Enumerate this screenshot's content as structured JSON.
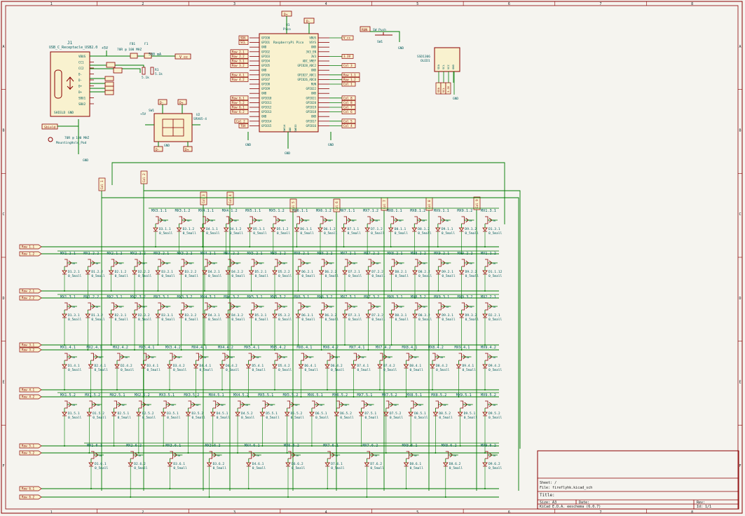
{
  "border": {
    "columns": [
      "1",
      "2",
      "3",
      "4",
      "5",
      "6",
      "7",
      "8"
    ],
    "rows": [
      "A",
      "B",
      "C",
      "D",
      "E",
      "F"
    ]
  },
  "title_block": {
    "sheet": "Sheet: /",
    "file": "File: fireflyhk.kicad_sch",
    "title": "Title:",
    "size": "Size: A3",
    "date": "Date:",
    "rev": "Rev:",
    "tool": "KiCad E.D.A.  eeschema (6.0.7)",
    "id": "Id: 1/1"
  },
  "usb": {
    "ref": "J1",
    "value": "USB_C_Receptacle_USB2.0",
    "fuse_ref": "F1",
    "fuse_value": "500 mA",
    "fb": "FB1",
    "fb_value": "70R @ 100 MHZ",
    "r1": "R1",
    "r2": "R2",
    "r_val": "5.1k",
    "net_vbus": "+5V",
    "net_vcc": "V_cc",
    "shield": "SHIELD",
    "gnd": "GND",
    "pins": [
      "VBUS",
      "CC1",
      "CC2",
      "D-",
      "D-",
      "D+",
      "D+",
      "SBU1",
      "SBU2"
    ],
    "mount_hole": "MountingHole_Pad",
    "fb2": "70R @ 100 MHZ",
    "shield_net": "Shield"
  },
  "esd": {
    "ref": "SW1",
    "chip": "U2",
    "chip_val": "SRV05-4",
    "labels": [
      "D-",
      "D+",
      "D-",
      "D+",
      "+5V"
    ],
    "gnd": "GND"
  },
  "mcu": {
    "ref": "U1",
    "value": "Pico",
    "name": "RaspberryPi Pico",
    "left_pins": [
      "GPIO0",
      "GPIO1",
      "GND",
      "GPIO2",
      "GPIO3",
      "GPIO4",
      "GPIO5",
      "GND",
      "GPIO6",
      "GPIO7",
      "GPIO8",
      "GPIO9",
      "GND",
      "GPIO10",
      "GPIO11",
      "GPIO12",
      "GPIO13",
      "GND",
      "GPIO14",
      "GPIO15"
    ],
    "right_pins": [
      "VBUS",
      "VSYS",
      "GND",
      "3V3_EN",
      "3V3",
      "ADC_VREF",
      "GPIO28_ADC2",
      "GND",
      "GPIO27_ADC1",
      "GPIO26_ADC0",
      "RUN",
      "GPIO22",
      "GND",
      "GPIO21",
      "GPIO20",
      "GPIO19",
      "GPIO18",
      "GND",
      "GPIO17",
      "GPIO16"
    ],
    "left_nets": [
      "SDA",
      "SCL",
      "",
      "Row 2.1",
      "Row 2.2",
      "Row 3.1",
      "Row 3.2",
      "",
      "Row 4.1",
      "Row 4.2",
      "",
      "",
      "",
      "Row 6.1",
      "Row 5.2",
      "Row 6.1",
      "Row 6.2",
      "",
      "Col 2",
      "TOX"
    ],
    "right_nets": [
      "V_cc",
      "",
      "",
      "",
      "3.3V",
      "",
      "Col 3",
      "",
      "Row 1.1",
      "Row 1.2",
      "Col 1",
      "",
      "",
      "Col 8",
      "Col 8",
      "Col 7",
      "Col 6",
      "",
      "Col 5",
      "Col 4"
    ],
    "top_nets": [
      "D+",
      "D-"
    ],
    "gnd": "GND",
    "swd": [
      "SWCLK",
      "GND",
      "SWDIO"
    ]
  },
  "reset": {
    "ref": "SW1",
    "value": "SW_Push",
    "net": "RUN",
    "gnd": "GND"
  },
  "oled": {
    "ref": "SSD1306",
    "value": "OLED1",
    "pins": [
      "SDA",
      "SCL",
      "VCC",
      "GND"
    ],
    "nets": [
      "SDA",
      "SCL",
      "3.3V"
    ],
    "gnd": "GND"
  },
  "matrix": {
    "col_nets": [
      "Col 1",
      "Col 2",
      "Col 3",
      "Col 4",
      "Col 5",
      "Col 6",
      "Col 7",
      "Col 8",
      "Col 9"
    ],
    "row_nets": [
      "Row 1.1",
      "Row 1.2",
      "Row 2.1",
      "Row 2.2",
      "Row 3.1",
      "Row 3.2",
      "Row 4.1",
      "Row 4.2",
      "Row 5.1",
      "Row 5.2",
      "Row 6.1",
      "Row 6.2"
    ],
    "diode_value": "0_5mall",
    "rows": [
      {
        "switches": [
          "MX3.1.1",
          "MX3.1.2",
          "MX4.1.1",
          "MX4.1.2",
          "MX5.1.1",
          "MX5.1.2",
          "MX6.1.1",
          "MX6.1.2",
          "MX7.1.1",
          "MX7.1.2",
          "MX8.1.1",
          "MX8.1.2",
          "MX9.1.1",
          "MX9.1.2",
          "MX1.3.1"
        ],
        "diodes": [
          "D3.1.1",
          "D3.1.2",
          "D4.1.1",
          "D4.1.2",
          "D5.1.1",
          "D5.1.2",
          "D6.1.1",
          "D6.1.2",
          "D7.1.1",
          "D7.1.2",
          "D8.1.1",
          "D8.1.2",
          "D9.1.1",
          "D9.1.2",
          "D1.3.1"
        ]
      },
      {
        "switches": [
          "MX1.2.1",
          "MX1.2.2",
          "MX2.1.2",
          "MX2.2.2",
          "MX3.2.1",
          "MX3.2.2",
          "MX4.2.1",
          "MX4.2.2",
          "MX5.2.1",
          "MX5.2.2",
          "MX6.2.1",
          "MX6.2.2",
          "MX7.2.1",
          "MX7.2.2",
          "MX8.2.1",
          "MX8.2.2",
          "MX9.2.1",
          "MX9.2.2",
          "MX1.1.2"
        ],
        "diodes": [
          "D1.2.1",
          "D1.2.2",
          "D2.1.2",
          "D2.2.2",
          "D3.2.1",
          "D3.2.2",
          "D4.2.1",
          "D4.2.2",
          "D5.2.1",
          "D5.2.2",
          "D6.2.1",
          "D6.2.2",
          "D7.2.1",
          "D7.2.2",
          "D8.2.1",
          "D8.2.2",
          "D9.2.1",
          "D9.2.2",
          "D1.1.12"
        ]
      },
      {
        "switches": [
          "MX1.3.1",
          "MX1.2.2",
          "MX2.3.1",
          "MX2.3.2",
          "MX3.3.1",
          "MX3.3.2",
          "MX4.3.1",
          "MX4.3.2",
          "MX5.3.1",
          "MX5.3.2",
          "MX6.3.1",
          "MX6.3.2",
          "MX7.3.1",
          "MX7.3.2",
          "MX8.3.1",
          "MX8.3.2",
          "MX9.3.1",
          "MX9.3.2",
          "MX2.2.1"
        ],
        "diodes": [
          "D1.3.1",
          "D1.3.2",
          "D2.3.1",
          "D2.3.2",
          "D3.3.1",
          "D3.3.2",
          "D4.3.1",
          "D4.3.2",
          "D5.3.1",
          "D5.3.2",
          "D6.3.1",
          "D6.3.2",
          "D7.3.1",
          "D7.3.2",
          "D8.3.1",
          "D8.3.2",
          "D9.3.1",
          "D9.3.2",
          "D2.2.1"
        ]
      },
      {
        "switches": [
          "MX1.4.1",
          "MX2.4.1",
          "MX2.4.2",
          "MX3.4.1",
          "MX3.4.2",
          "MX4.4.1",
          "MX4.4.2",
          "MX5.4.1",
          "MX5.4.2",
          "MX6.4.1",
          "MX6.4.2",
          "MX7.4.1",
          "MX7.4.2",
          "MX8.4.1",
          "MX8.4.2",
          "MX9.4.1",
          "MX9.4.2"
        ],
        "diodes": [
          "D1.4.1",
          "D2.4.1",
          "D2.4.2",
          "D3.4.1",
          "D3.4.2",
          "D4.4.1",
          "D4.4.2",
          "D5.4.1",
          "D5.4.2",
          "D6.4.1",
          "D6.4.2",
          "D7.4.1",
          "D7.4.2",
          "D8.4.1",
          "D8.4.2",
          "D9.4.1",
          "D9.4.2"
        ]
      },
      {
        "switches": [
          "MX1.5.2",
          "MX1.5.2",
          "MX2.5.1",
          "MX2.5.2",
          "MX3.5.1",
          "MX3.5.2",
          "MX4.5.1",
          "MX4.5.2",
          "MX5.5.1",
          "MX5.5.2",
          "MX6.5.1",
          "MX6.5.2",
          "MX7.5.1",
          "MX7.5.2",
          "MX8.5.1",
          "MX8.5.2",
          "MX9.5.1",
          "MX9.5.2"
        ],
        "diodes": [
          "D1.5.1",
          "D1.5.2",
          "D2.5.1",
          "D2.5.2",
          "D3.5.1",
          "D3.5.2",
          "D4.5.1",
          "D4.5.2",
          "D5.5.1",
          "D5.5.2",
          "D6.5.1",
          "D6.5.2",
          "D7.5.1",
          "D7.5.2",
          "D8.5.1",
          "D8.5.2",
          "D9.5.1",
          "D9.5.2"
        ]
      },
      {
        "switches": [
          "MX1.6.1",
          "MX2.6.2",
          "MX3.6.1",
          "MX3.6.2",
          "MX4.6.1",
          "MX6.6.2",
          "MX7.6.1",
          "MX7.6.2",
          "MX8.6.1",
          "MX8.6.2",
          "MX9.6.2"
        ],
        "diodes": [
          "D1.6.1",
          "D2.6.2",
          "D3.6.1",
          "D3.6.2",
          "D4.6.1",
          "D6.6.2",
          "D7.6.1",
          "D7.6.2",
          "D8.6.1",
          "D8.6.2",
          "D9.6.2"
        ]
      }
    ]
  }
}
